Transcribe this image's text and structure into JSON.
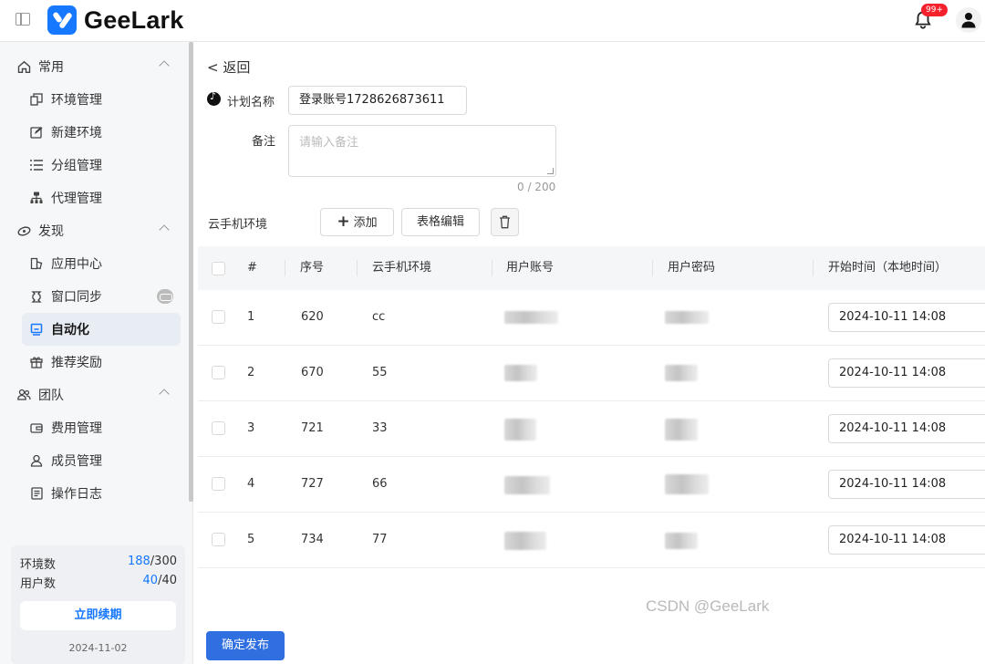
{
  "app": {
    "name": "GeeLark",
    "notification_badge": "99+"
  },
  "sidebar": {
    "groups": [
      {
        "label": "常用",
        "children": [
          "环境管理",
          "新建环境",
          "分组管理",
          "代理管理"
        ]
      },
      {
        "label": "发现",
        "children": [
          "应用中心",
          "窗口同步",
          "自动化",
          "推荐奖励"
        ]
      },
      {
        "label": "团队",
        "children": [
          "费用管理",
          "成员管理",
          "操作日志"
        ]
      }
    ],
    "active": "自动化",
    "usage": {
      "env_label": "环境数",
      "env_used": "188",
      "env_total": "/300",
      "user_label": "用户数",
      "user_used": "40",
      "user_total": "/40"
    },
    "renew_label": "立即续期",
    "expire_date": "2024-11-02"
  },
  "form": {
    "back_label": "< 返回",
    "plan_name_label": "计划名称",
    "plan_name_value": "登录账号1728626873611",
    "note_label": "备注",
    "note_placeholder": "请输入备注",
    "note_counter": "0 / 200",
    "env_section_label": "云手机环境",
    "add_label": "添加",
    "table_edit_label": "表格编辑"
  },
  "table": {
    "columns": [
      "#",
      "序号",
      "云手机环境",
      "用户账号",
      "用户密码",
      "开始时间（本地时间）"
    ],
    "rows": [
      {
        "idx": "1",
        "seq": "620",
        "env": "cc",
        "time": "2024-10-11 14:08"
      },
      {
        "idx": "2",
        "seq": "670",
        "env": "55",
        "time": "2024-10-11 14:08"
      },
      {
        "idx": "3",
        "seq": "721",
        "env": "33",
        "time": "2024-10-11 14:08"
      },
      {
        "idx": "4",
        "seq": "727",
        "env": "66",
        "time": "2024-10-11 14:08"
      },
      {
        "idx": "5",
        "seq": "734",
        "env": "77",
        "time": "2024-10-11 14:08"
      }
    ]
  },
  "publish_label": "确定发布",
  "watermark": "CSDN @GeeLark"
}
